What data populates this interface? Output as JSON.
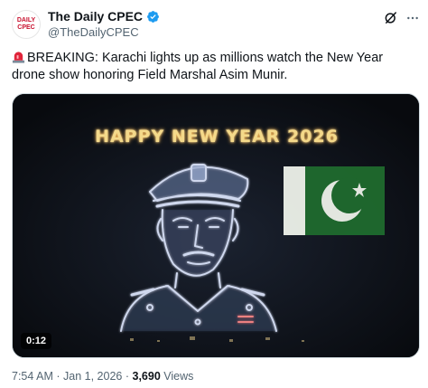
{
  "account": {
    "display_name": "The Daily CPEC",
    "handle": "@TheDailyCPEC",
    "avatar_text": [
      "DAILY",
      "CPEC"
    ]
  },
  "tweet": {
    "text": "BREAKING: Karachi lights up as millions watch the New Year drone show honoring Field Marshal Asim Munir."
  },
  "media": {
    "overlay_text": "HAPPY NEW YEAR 2026",
    "duration": "0:12"
  },
  "footer": {
    "time": "7:54 AM",
    "separator": "·",
    "date": "Jan 1, 2026",
    "views_count": "3,690",
    "views_label": "Views"
  },
  "colors": {
    "verified": "#1d9bf0",
    "secondary_text": "#536471",
    "flag_green": "#01411c"
  },
  "icons": [
    "verified-badge-icon",
    "grok-icon",
    "more-icon",
    "siren-emoji-icon"
  ]
}
